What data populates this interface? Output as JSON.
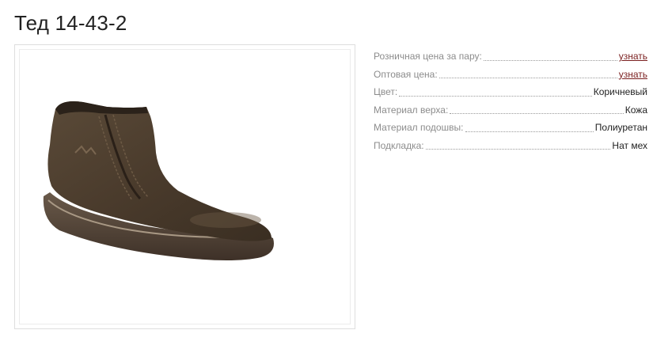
{
  "product": {
    "title": "Тед 14-43-2",
    "image_alt": "shoe-photo"
  },
  "specs": [
    {
      "label": "Розничная цена за пару:",
      "value": "узнать",
      "is_link": true
    },
    {
      "label": "Оптовая цена:",
      "value": "узнать",
      "is_link": true
    },
    {
      "label": "Цвет:",
      "value": "Коричневый",
      "is_link": false
    },
    {
      "label": "Материал верха:",
      "value": "Кожа",
      "is_link": false
    },
    {
      "label": "Материал подошвы:",
      "value": "Полиуретан",
      "is_link": false
    },
    {
      "label": "Подкладка:",
      "value": "Нат мех",
      "is_link": false
    }
  ],
  "colors": {
    "link": "#7a1f1f",
    "label": "#8c8c8c",
    "text": "#222222",
    "frame": "#dedede"
  }
}
